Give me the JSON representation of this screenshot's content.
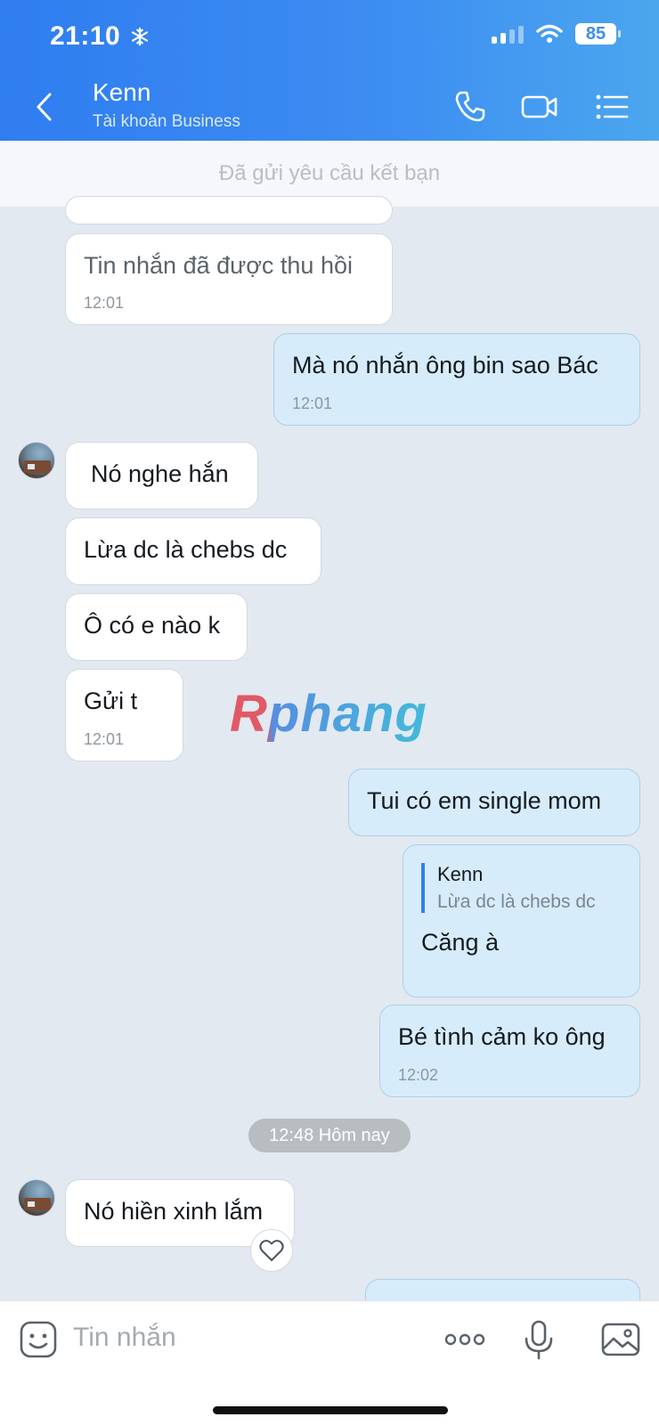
{
  "status": {
    "time": "21:10",
    "battery": "85"
  },
  "header": {
    "name": "Kenn",
    "subtitle": "Tài khoản Business"
  },
  "notice": "Đã gửi yêu cầu kết bạn",
  "messages": [
    {
      "text": "Tin nhắn đã được thu hồi",
      "time": "12:01"
    },
    {
      "text": "Mà nó nhắn ông bin sao Bác",
      "time": "12:01"
    },
    {
      "text": "Nó nghe hắn"
    },
    {
      "text": "Lừa dc là chebs dc"
    },
    {
      "text": "Ô có e nào k"
    },
    {
      "text": "Gửi t",
      "time": "12:01"
    },
    {
      "text": "Tui có em single mom"
    },
    {
      "reply_author": "Kenn",
      "reply_text": "Lừa dc là chebs dc",
      "text": "Căng à"
    },
    {
      "text": "Bé tình cảm ko ông",
      "time": "12:02"
    },
    {
      "text": "Nó hiền xinh lắm"
    }
  ],
  "date_divider": "12:48 Hôm nay",
  "watermark": "Rphang",
  "composer": {
    "placeholder": "Tin nhắn"
  },
  "colors": {
    "header_start": "#2f7df0",
    "header_end": "#4ba6ee",
    "outgoing_bubble": "#d6ecfb",
    "incoming_bubble": "#ffffff",
    "accent": "#2f80ed"
  }
}
